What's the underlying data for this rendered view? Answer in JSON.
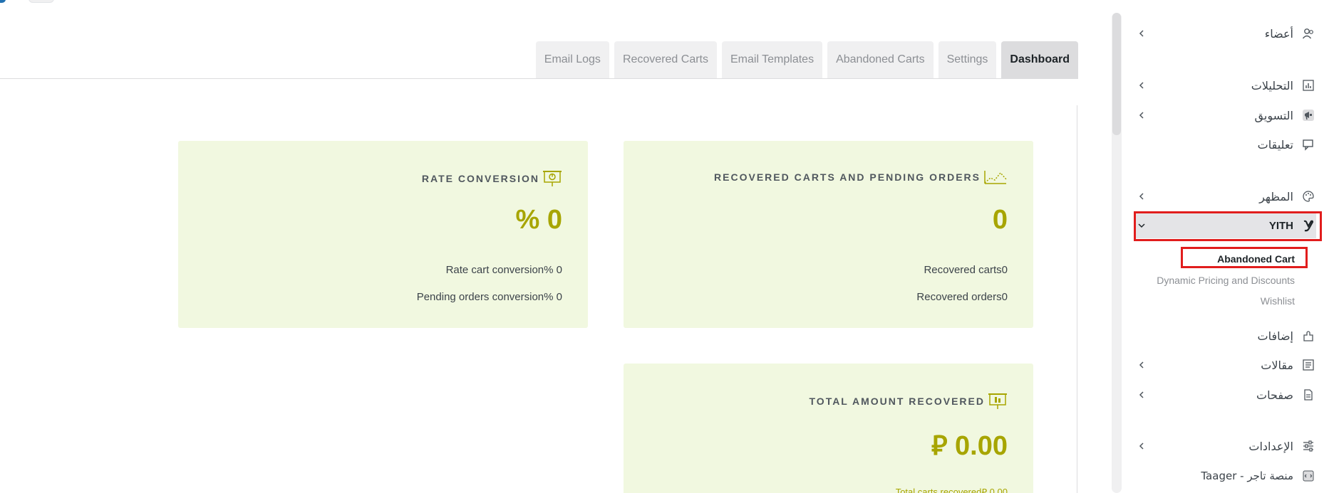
{
  "tabs": [
    {
      "label": "Dashboard",
      "active": true
    },
    {
      "label": "Settings"
    },
    {
      "label": "Abandoned Carts"
    },
    {
      "label": "Email Templates"
    },
    {
      "label": "Recovered Carts"
    },
    {
      "label": "Email Logs"
    }
  ],
  "cards": {
    "recovered": {
      "title": "RECOVERED CARTS AND PENDING ORDERS",
      "value": "0",
      "line1": "Recovered carts0",
      "line2": "Recovered orders0",
      "icon": "line-chart-icon"
    },
    "conversion": {
      "title": "RATE CONVERSION",
      "value": "% 0",
      "line1": "Rate cart conversion% 0",
      "line2": "Pending orders conversion% 0",
      "icon": "pie-board-icon"
    },
    "total": {
      "title": "TOTAL AMOUNT RECOVERED",
      "value": "0.00",
      "currency": "⃁",
      "line1": "Total carts recovered⃁ 0.00",
      "icon": "bar-board-icon"
    }
  },
  "sidebar": {
    "items": [
      {
        "label": "أعضاء",
        "icon": "users-icon",
        "chevron": true
      },
      {
        "label": "التحليلات",
        "icon": "analytics-icon",
        "chevron": true
      },
      {
        "label": "التسويق",
        "icon": "megaphone-icon",
        "chevron": true
      },
      {
        "label": "تعليقات",
        "icon": "comments-icon",
        "chevron": false
      },
      {
        "label": "المظهر",
        "icon": "palette-icon",
        "chevron": true
      },
      {
        "label": "YITH",
        "icon": "yith-icon",
        "chevron": true
      },
      {
        "label": "إضافات",
        "icon": "plugins-icon",
        "chevron": false
      },
      {
        "label": "مقالات",
        "icon": "posts-icon",
        "chevron": true
      },
      {
        "label": "صفحات",
        "icon": "pages-icon",
        "chevron": true
      },
      {
        "label": "الإعدادات",
        "icon": "settings-icon",
        "chevron": true
      },
      {
        "label": "Taager - منصة تاجر",
        "icon": "taager-icon",
        "chevron": false
      }
    ],
    "yith_sub": [
      "Abandoned Cart",
      "Dynamic Pricing and Discounts",
      "Wishlist"
    ]
  },
  "colors": {
    "accent": "#a7a500",
    "card_bg": "#f1f8e0",
    "highlight": "#e11d1d"
  }
}
